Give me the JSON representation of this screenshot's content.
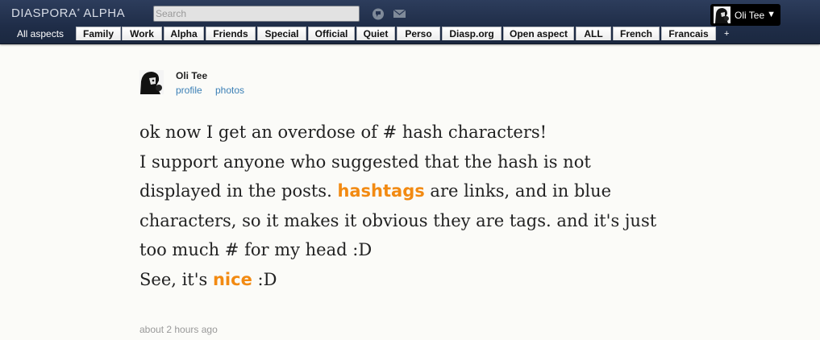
{
  "header": {
    "brand_main": "DIASPORA",
    "brand_star": "*",
    "brand_suffix": " ALPHA",
    "search_placeholder": "Search",
    "user_name": "Oli Tee",
    "caret": "▼",
    "icons": [
      "notifications-icon",
      "mail-icon"
    ]
  },
  "aspects": {
    "all_label": "All aspects",
    "tabs": [
      {
        "label": "Family"
      },
      {
        "label": "Work"
      },
      {
        "label": "Alpha"
      },
      {
        "label": "Friends"
      },
      {
        "label": "Special"
      },
      {
        "label": "Official"
      },
      {
        "label": "Quiet"
      },
      {
        "label": "Perso"
      },
      {
        "label": "Diasp.org"
      },
      {
        "label": "Open aspect"
      },
      {
        "label": "ALL"
      },
      {
        "label": "French"
      },
      {
        "label": "Francais"
      }
    ],
    "add_label": "+"
  },
  "post": {
    "author": "Oli Tee",
    "profile_link": "profile",
    "photos_link": "photos",
    "line1": "ok now I get an overdose of # hash characters!",
    "line2": "I support anyone who suggested that the hash is not",
    "line3_before": "displayed in the posts. ",
    "tag1": "hashtags",
    "line3_after": " are links, and in blue",
    "line4": "characters, so it makes it obvious they are tags. and it's just",
    "line5": "too much # for my head :D",
    "line6_before": "See, it's ",
    "tag2": "nice",
    "line6_after": " :D",
    "timestamp": "about 2 hours ago"
  },
  "colors": {
    "header_bg": "#22304d",
    "tag": "#f28a12",
    "link": "#3a7fb5"
  }
}
